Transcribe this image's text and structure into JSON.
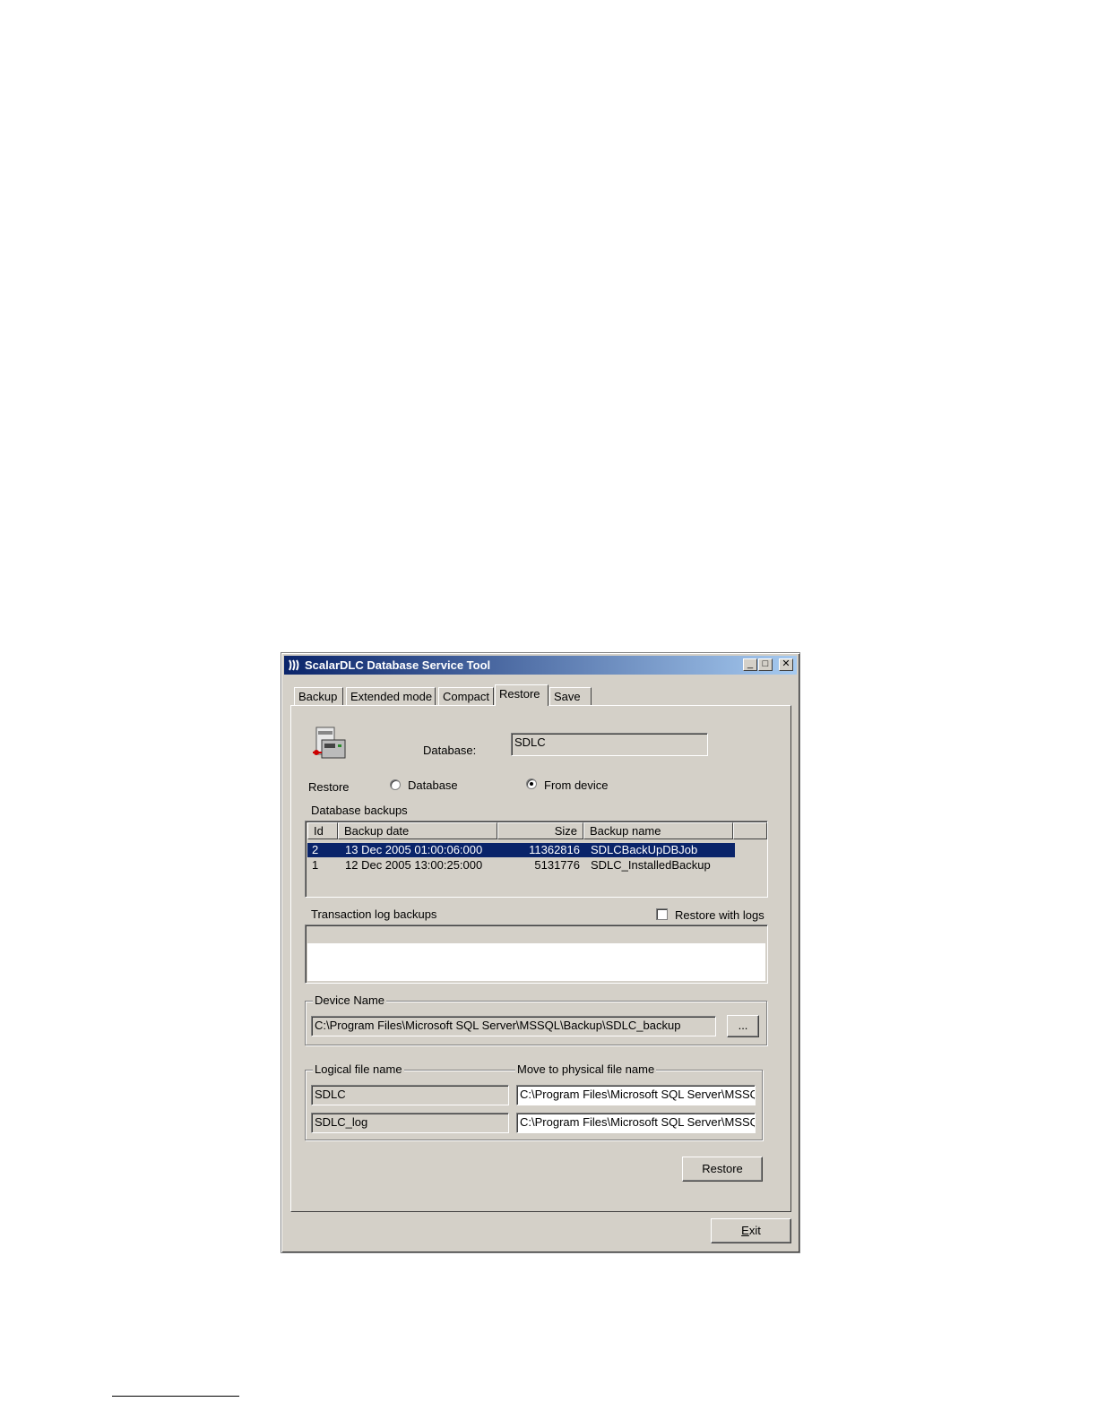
{
  "window": {
    "title": "ScalarDLC Database Service Tool",
    "app_icon": "scalar-logo-icon",
    "controls": [
      "_",
      "□",
      "✕"
    ]
  },
  "tabs": [
    {
      "label": "Backup",
      "active": false
    },
    {
      "label": "Extended mode",
      "active": false
    },
    {
      "label": "Compact",
      "active": false
    },
    {
      "label": "Restore",
      "active": true
    },
    {
      "label": "Save",
      "active": false
    }
  ],
  "restore_panel": {
    "icon": "database-restore-icon",
    "database_label": "Database:",
    "database_value": "SDLC",
    "restore_label": "Restore",
    "radio_database": {
      "label": "Database",
      "checked": false
    },
    "radio_from_device": {
      "label": "From device",
      "checked": true
    },
    "backups_label": "Database backups",
    "backups_columns": [
      "Id",
      "Backup date",
      "Size",
      "Backup name"
    ],
    "backups_rows": [
      {
        "id": "2",
        "date": "13 Dec 2005 01:00:06:000",
        "size": "11362816",
        "name": "SDLCBackUpDBJob",
        "selected": true
      },
      {
        "id": "1",
        "date": "12 Dec 2005 13:00:25:000",
        "size": "5131776",
        "name": "SDLC_InstalledBackup",
        "selected": false
      }
    ],
    "translog_label": "Transaction log backups",
    "restore_with_logs": {
      "label": "Restore with logs",
      "checked": false
    },
    "device_name_title": "Device Name",
    "device_name_value": "C:\\Program Files\\Microsoft SQL Server\\MSSQL\\Backup\\SDLC_backup",
    "browse_label": "...",
    "logical_title": "Logical file name",
    "physical_title": "Move to physical file name",
    "logical_files": [
      "SDLC",
      "SDLC_log"
    ],
    "physical_files": [
      "C:\\Program Files\\Microsoft SQL Server\\MSSQL",
      "C:\\Program Files\\Microsoft SQL Server\\MSSQL"
    ],
    "restore_button": "Restore"
  },
  "exit_button": {
    "label": "Exit",
    "mnemonic": "E",
    "rest": "xit"
  },
  "colors": {
    "titlebar_start": "#0a246a",
    "titlebar_end": "#a6caf0",
    "face": "#d4d0c8",
    "selection": "#0a246a"
  }
}
